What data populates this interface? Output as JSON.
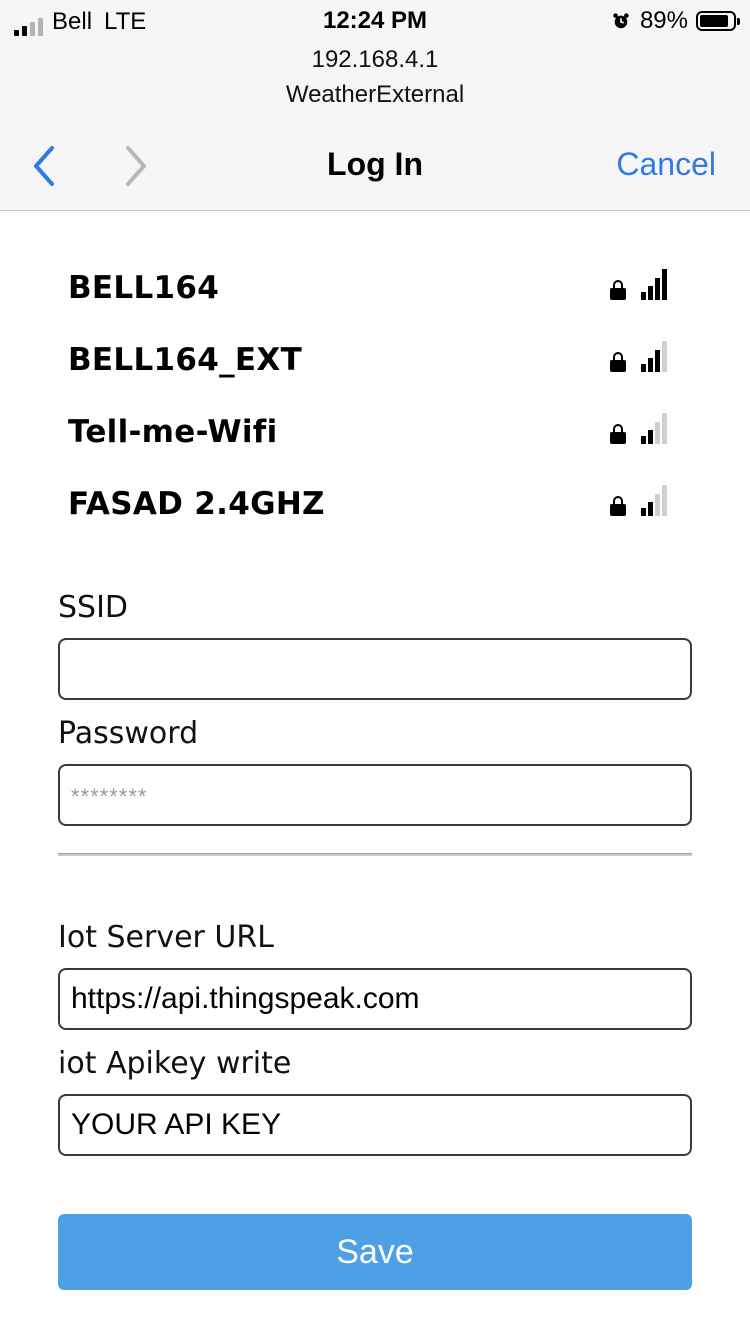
{
  "status_bar": {
    "carrier": "Bell",
    "network": "LTE",
    "time": "12:24 PM",
    "battery": "89%",
    "battery_level": 0.89,
    "signal_bars": 2,
    "icons": [
      "signal-icon",
      "alarm-icon",
      "battery-icon"
    ]
  },
  "browser": {
    "url": "192.168.4.1",
    "page_title": "WeatherExternal",
    "nav_title": "Log In",
    "cancel_label": "Cancel",
    "icons": [
      "back-chevron-icon",
      "forward-chevron-icon"
    ]
  },
  "networks": [
    {
      "name": "BELL164",
      "locked": true,
      "signal": 4
    },
    {
      "name": "BELL164_EXT",
      "locked": true,
      "signal": 3
    },
    {
      "name": "Tell-me-Wifi",
      "locked": true,
      "signal": 2
    },
    {
      "name": "FASAD 2.4GHZ",
      "locked": true,
      "signal": 2
    }
  ],
  "form": {
    "ssid_label": "SSID",
    "ssid_value": "",
    "password_label": "Password",
    "password_placeholder": "********",
    "iot_url_label": "Iot Server URL",
    "iot_url_value": "https://api.thingspeak.com",
    "apikey_label": "iot Apikey write",
    "apikey_value": "YOUR API KEY",
    "save_label": "Save"
  },
  "colors": {
    "accent": "#2f7ae5",
    "save_button": "#4ea0e6",
    "header_bg": "#f6f6f8"
  }
}
